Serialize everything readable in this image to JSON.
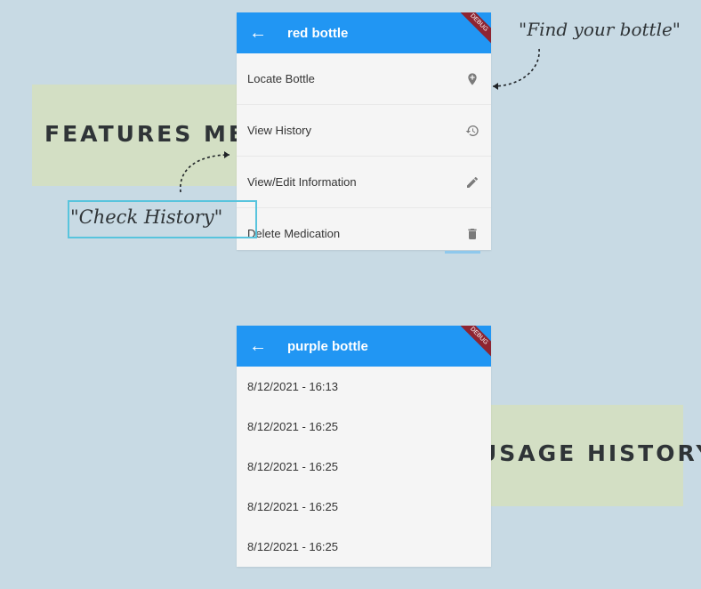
{
  "features_note": {
    "label": "FEATURES MENU"
  },
  "usage_note": {
    "label": "USAGE HISTORY"
  },
  "callouts": {
    "find_bottle": "\"Find your bottle\"",
    "check_history": "\"Check History\""
  },
  "top_screen": {
    "title": "red bottle",
    "debug_label": "DEBUG",
    "items": [
      {
        "label": "Locate Bottle",
        "icon": "location-pin-icon"
      },
      {
        "label": "View History",
        "icon": "history-icon"
      },
      {
        "label": "View/Edit Information",
        "icon": "edit-icon"
      },
      {
        "label": "Delete Medication",
        "icon": "trash-icon"
      }
    ]
  },
  "bottom_screen": {
    "title": "purple bottle",
    "debug_label": "DEBUG",
    "history": [
      "8/12/2021 - 16:13",
      "8/12/2021 - 16:25",
      "8/12/2021 - 16:25",
      "8/12/2021 - 16:25",
      "8/12/2021 - 16:25"
    ]
  },
  "colors": {
    "background": "#c8dae4",
    "card": "#d3dfc4",
    "appbar": "#2196f3",
    "highlight": "#58c4dd"
  }
}
